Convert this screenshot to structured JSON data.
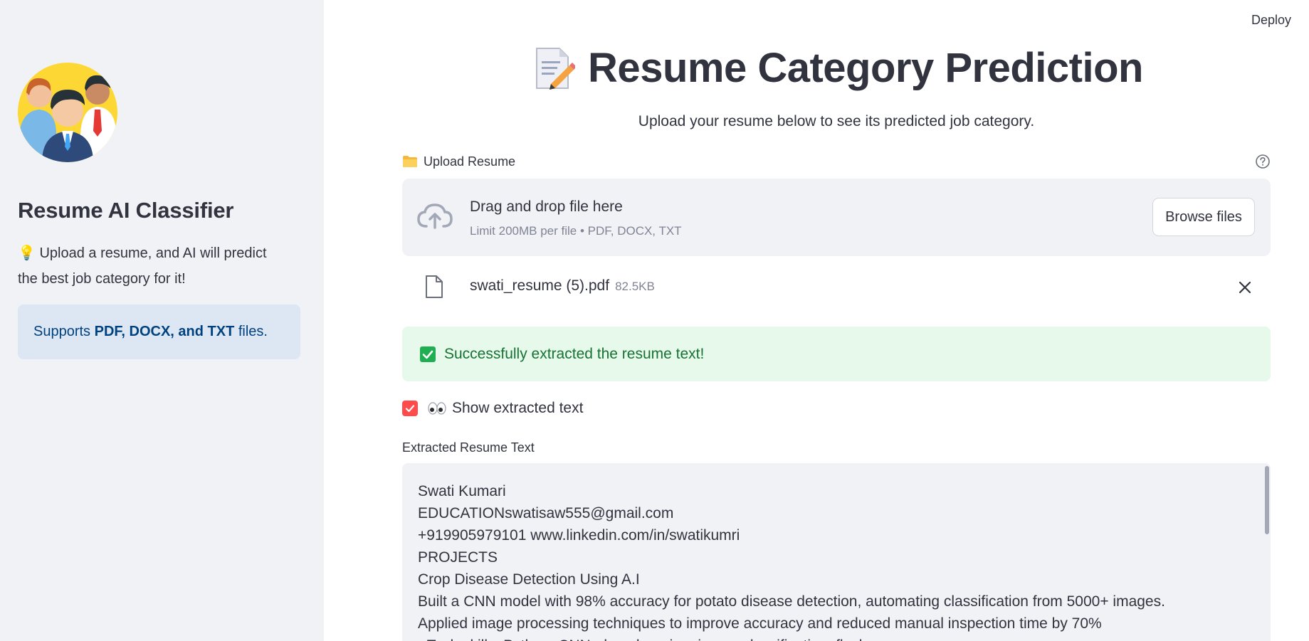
{
  "header": {
    "deploy_label": "Deploy"
  },
  "sidebar": {
    "title": "Resume AI Classifier",
    "description": "💡 Upload a resume, and AI will predict the best job category for it!",
    "info_prefix": "Supports ",
    "info_bold": "PDF, DOCX, and TXT",
    "info_suffix": " files."
  },
  "main": {
    "title": "Resume Category Prediction",
    "subtitle": "Upload your resume below to see its predicted job category.",
    "upload": {
      "label": "Upload Resume",
      "dropzone_text": "Drag and drop file here",
      "dropzone_limit": "Limit 200MB per file • PDF, DOCX, TXT",
      "browse_label": "Browse files"
    },
    "file": {
      "name": "swati_resume (5).pdf",
      "size": "82.5KB"
    },
    "success_message": "Successfully extracted the resume text!",
    "show_text_checkbox": {
      "label": "Show extracted text",
      "checked": true
    },
    "extracted_label": "Extracted Resume Text",
    "extracted_lines": [
      "Swati Kumari",
      "EDUCATIONswatisaw555@gmail.com",
      "+919905979101 www.linkedin.com/in/swatikumri",
      "PROJECTS",
      "Crop Disease Detection Using A.I",
      "Built a CNN model with 98% accuracy for potato disease detection, automating classification from 5000+ images.",
      "Applied image processing techniques to improve accuracy and reduced manual inspection time by 70%",
      "• Tech skills: Python, CNN, deep learning, image classification, flask"
    ]
  },
  "colors": {
    "sidebar_bg": "#f0f2f6",
    "info_bg": "#dde7f3",
    "info_text": "#004280",
    "success_bg": "#e6f9ea",
    "success_text": "#177233",
    "checkbox": "#ff4b4b",
    "text": "#31333f"
  }
}
